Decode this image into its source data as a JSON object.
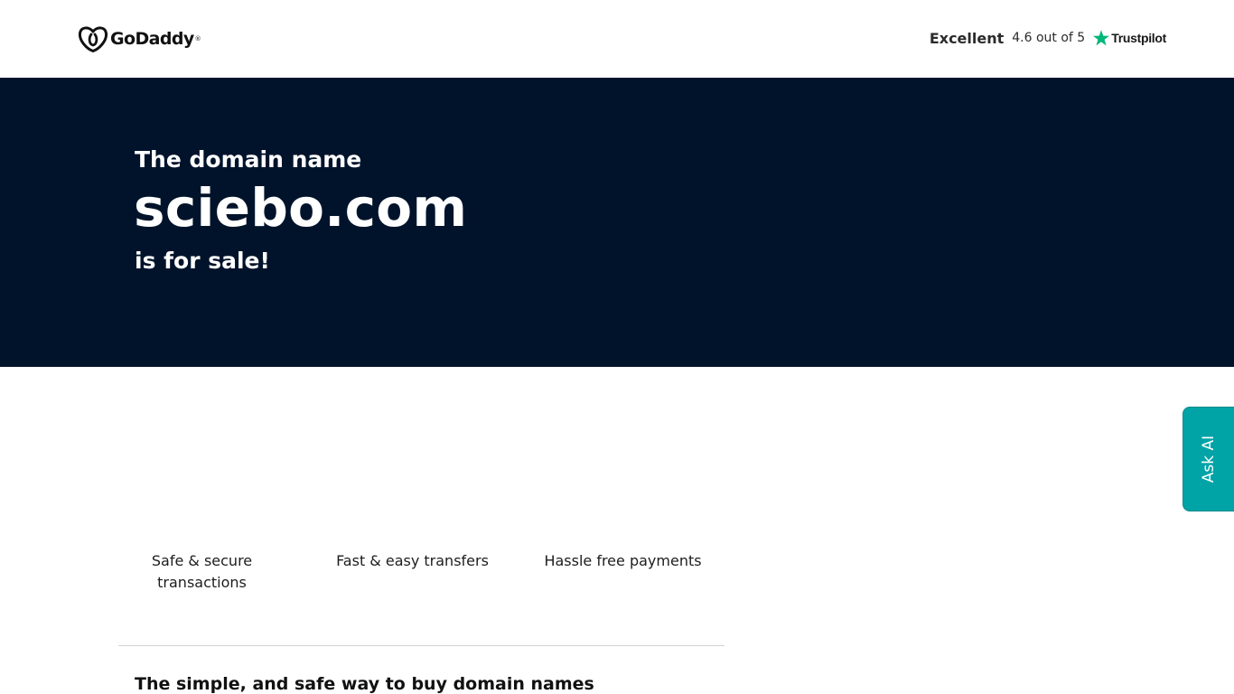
{
  "header": {
    "logo": {
      "text": "GoDaddy",
      "tm": "®",
      "icon": "godaddy-logo-icon"
    },
    "trustpilot": {
      "rating_label": "Excellent",
      "score_text": "4.6 out of 5",
      "brand": "Trustpilot",
      "star_icon": "star-icon",
      "star_color": "#00b67a"
    }
  },
  "hero": {
    "pre_text": "The domain name",
    "domain": "sciebo.com",
    "post_text": "is for sale!",
    "background": "#00132b"
  },
  "features": [
    {
      "label": "Safe & secure transactions"
    },
    {
      "label": "Fast & easy transfers"
    },
    {
      "label": "Hassle free payments"
    }
  ],
  "info": {
    "heading": "The simple, and safe way to buy domain names"
  },
  "ask_ai": {
    "label": "Ask AI",
    "color": "#00a4a6"
  }
}
